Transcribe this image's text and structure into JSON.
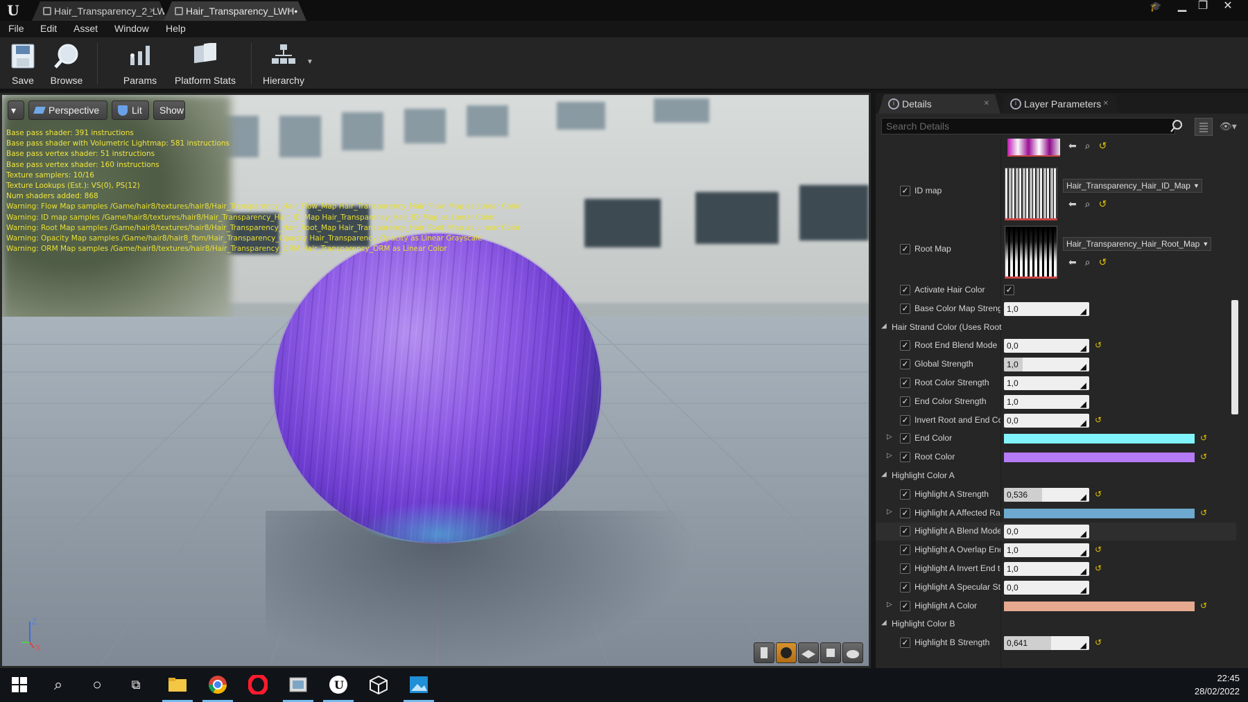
{
  "window": {
    "tabs": [
      {
        "label": "Hair_Transparency_2_LW•"
      },
      {
        "label": "Hair_Transparency_LWH•"
      }
    ],
    "controls": [
      "minimize",
      "restore",
      "close"
    ]
  },
  "menu": [
    "File",
    "Edit",
    "Asset",
    "Window",
    "Help"
  ],
  "toolbar": {
    "save": "Save",
    "browse": "Browse",
    "params": "Params",
    "platform_stats": "Platform Stats",
    "hierarchy": "Hierarchy"
  },
  "viewport": {
    "perspective": "Perspective",
    "lit": "Lit",
    "show": "Show",
    "stats": [
      "Base pass shader: 391 instructions",
      "Base pass shader with Volumetric Lightmap: 581 instructions",
      "Base pass vertex shader: 51 instructions",
      "Base pass vertex shader: 160 instructions",
      "Texture samplers: 10/16",
      "Texture Lookups (Est.): VS(0), PS(12)",
      "Num shaders added: 868",
      "Warning: Flow Map samples /Game/hair8/textures/hair8/Hair_Transparency_Hair_Flow_Map Hair_Transparency_Hair_Flow_Map as Linear Color",
      "Warning: ID map samples /Game/hair8/textures/hair8/Hair_Transparency_Hair_ID_Map Hair_Transparency_Hair_ID_Map as Linear Color",
      "Warning: Root Map samples /Game/hair8/textures/hair8/Hair_Transparency_Hair_Root_Map Hair_Transparency_Hair_Root_Map as Linear Color",
      "Warning: Opacity Map samples /Game/hair8/hair8_fbm/Hair_Transparency_Opacity Hair_Transparency_Opacity as Linear Grayscale",
      "Warning: ORM Map samples /Game/hair8/textures/hair8/Hair_Transparency_ORM Hair_Transparency_ORM as Linear Color"
    ],
    "axis_z": "Z",
    "axis_x": "X"
  },
  "panel": {
    "tabs": [
      "Details",
      "Layer Parameters"
    ],
    "search_placeholder": "Search Details",
    "textures": [
      {
        "label": "ID map",
        "asset": "Hair_Transparency_Hair_ID_Map"
      },
      {
        "label": "Root Map",
        "asset": "Hair_Transparency_Hair_Root_Map"
      }
    ],
    "rows": [
      {
        "type": "bool",
        "label": "Activate Hair Color",
        "checked": true
      },
      {
        "type": "num",
        "label": "Base Color Map Streng",
        "value": "1,0",
        "fill": 0,
        "reset": false
      },
      {
        "type": "category",
        "label": "Hair Strand Color (Uses Root"
      },
      {
        "type": "num",
        "label": "Root End Blend Mode",
        "value": "0,0",
        "fill": 0,
        "reset": true
      },
      {
        "type": "num",
        "label": "Global Strength",
        "value": "1,0",
        "fill": 0.22,
        "reset": false
      },
      {
        "type": "num",
        "label": "Root Color Strength",
        "value": "1,0",
        "fill": 0,
        "reset": false
      },
      {
        "type": "num",
        "label": "End Color Strength",
        "value": "1,0",
        "fill": 0,
        "reset": false
      },
      {
        "type": "num",
        "label": "Invert Root and End Col",
        "value": "0,0",
        "fill": 0,
        "reset": true
      },
      {
        "type": "color",
        "label": "End Color",
        "color": "#80f4fa"
      },
      {
        "type": "color",
        "label": "Root Color",
        "color": "#b57af6"
      },
      {
        "type": "category",
        "label": "Highlight Color A"
      },
      {
        "type": "num",
        "label": "Highlight A Strength",
        "value": "0,536",
        "fill": 0.45,
        "reset": true
      },
      {
        "type": "color",
        "label": "Highlight A Affected Ra",
        "color": "#6ea9cf"
      },
      {
        "type": "num",
        "label": "Highlight A Blend Mode",
        "value": "0,0",
        "fill": 0,
        "reset": false,
        "highlight": true
      },
      {
        "type": "num",
        "label": "Highlight A Overlap End",
        "value": "1,0",
        "fill": 0,
        "reset": true
      },
      {
        "type": "num",
        "label": "Highlight A Invert End to",
        "value": "1,0",
        "fill": 0,
        "reset": true
      },
      {
        "type": "num",
        "label": "Highlight A Specular Str",
        "value": "0,0",
        "fill": 0,
        "reset": false
      },
      {
        "type": "color",
        "label": "Highlight A Color",
        "color": "#e5a98f"
      },
      {
        "type": "category",
        "label": "Highlight Color B"
      },
      {
        "type": "num",
        "label": "Highlight B Strength",
        "value": "0,641",
        "fill": 0.55,
        "reset": true
      }
    ]
  },
  "taskbar": {
    "time": "22:45",
    "date": "28/02/2022"
  }
}
